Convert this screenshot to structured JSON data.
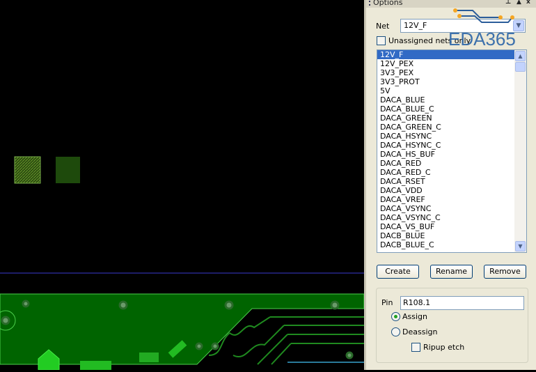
{
  "panel": {
    "title": "Options",
    "pin_icon": "pin-icon",
    "close_label": "x",
    "net_label": "Net",
    "net_value": "12V_F",
    "unassigned_label": "Unassigned nets only",
    "unassigned_checked": false,
    "nets": [
      "12V_F",
      "12V_PEX",
      "3V3_PEX",
      "3V3_PROT",
      "5V",
      "DACA_BLUE",
      "DACA_BLUE_C",
      "DACA_GREEN",
      "DACA_GREEN_C",
      "DACA_HSYNC",
      "DACA_HSYNC_C",
      "DACA_HS_BUF",
      "DACA_RED",
      "DACA_RED_C",
      "DACA_RSET",
      "DACA_VDD",
      "DACA_VREF",
      "DACA_VSYNC",
      "DACA_VSYNC_C",
      "DACA_VS_BUF",
      "DACB_BLUE",
      "DACB_BLUE_C"
    ],
    "selected_net": "12V_F",
    "buttons": {
      "create": "Create",
      "rename": "Rename",
      "remove": "Remove"
    },
    "pin_label": "Pin",
    "pin_value": "R108.1",
    "assign_label": "Assign",
    "deassign_label": "Deassign",
    "mode": "Assign",
    "ripup_label": "Ripup etch",
    "ripup_checked": false
  },
  "watermark": "EDA365",
  "colors": {
    "copper": "#006400",
    "copper_edge": "#4ccf4c",
    "selection": "#316ac5",
    "board_outline": "#3a3ad0"
  }
}
